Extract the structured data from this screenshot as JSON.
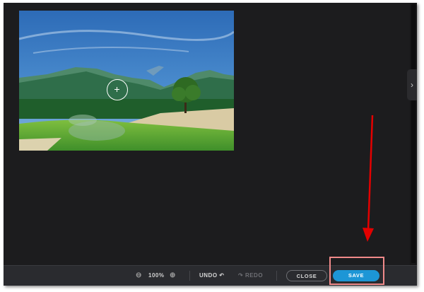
{
  "editor": {
    "zoom": {
      "value": "100%"
    },
    "undo_label": "UNDO",
    "redo_label": "REDO",
    "close_label": "CLOSE",
    "save_label": "SAVE",
    "side_handle_glyph": "›"
  },
  "icons": {
    "zoom_out": "zoom-out-icon",
    "zoom_in": "zoom-in-icon",
    "undo": "undo-icon",
    "redo": "redo-icon",
    "panel_toggle": "chevron-right-icon"
  },
  "colors": {
    "workspace": "#1c1c1e",
    "toolbar": "#2a2b2f",
    "save_accent": "#1d96d6",
    "annotation_arrow": "#e30000",
    "annotation_box": "#f08a8a"
  }
}
